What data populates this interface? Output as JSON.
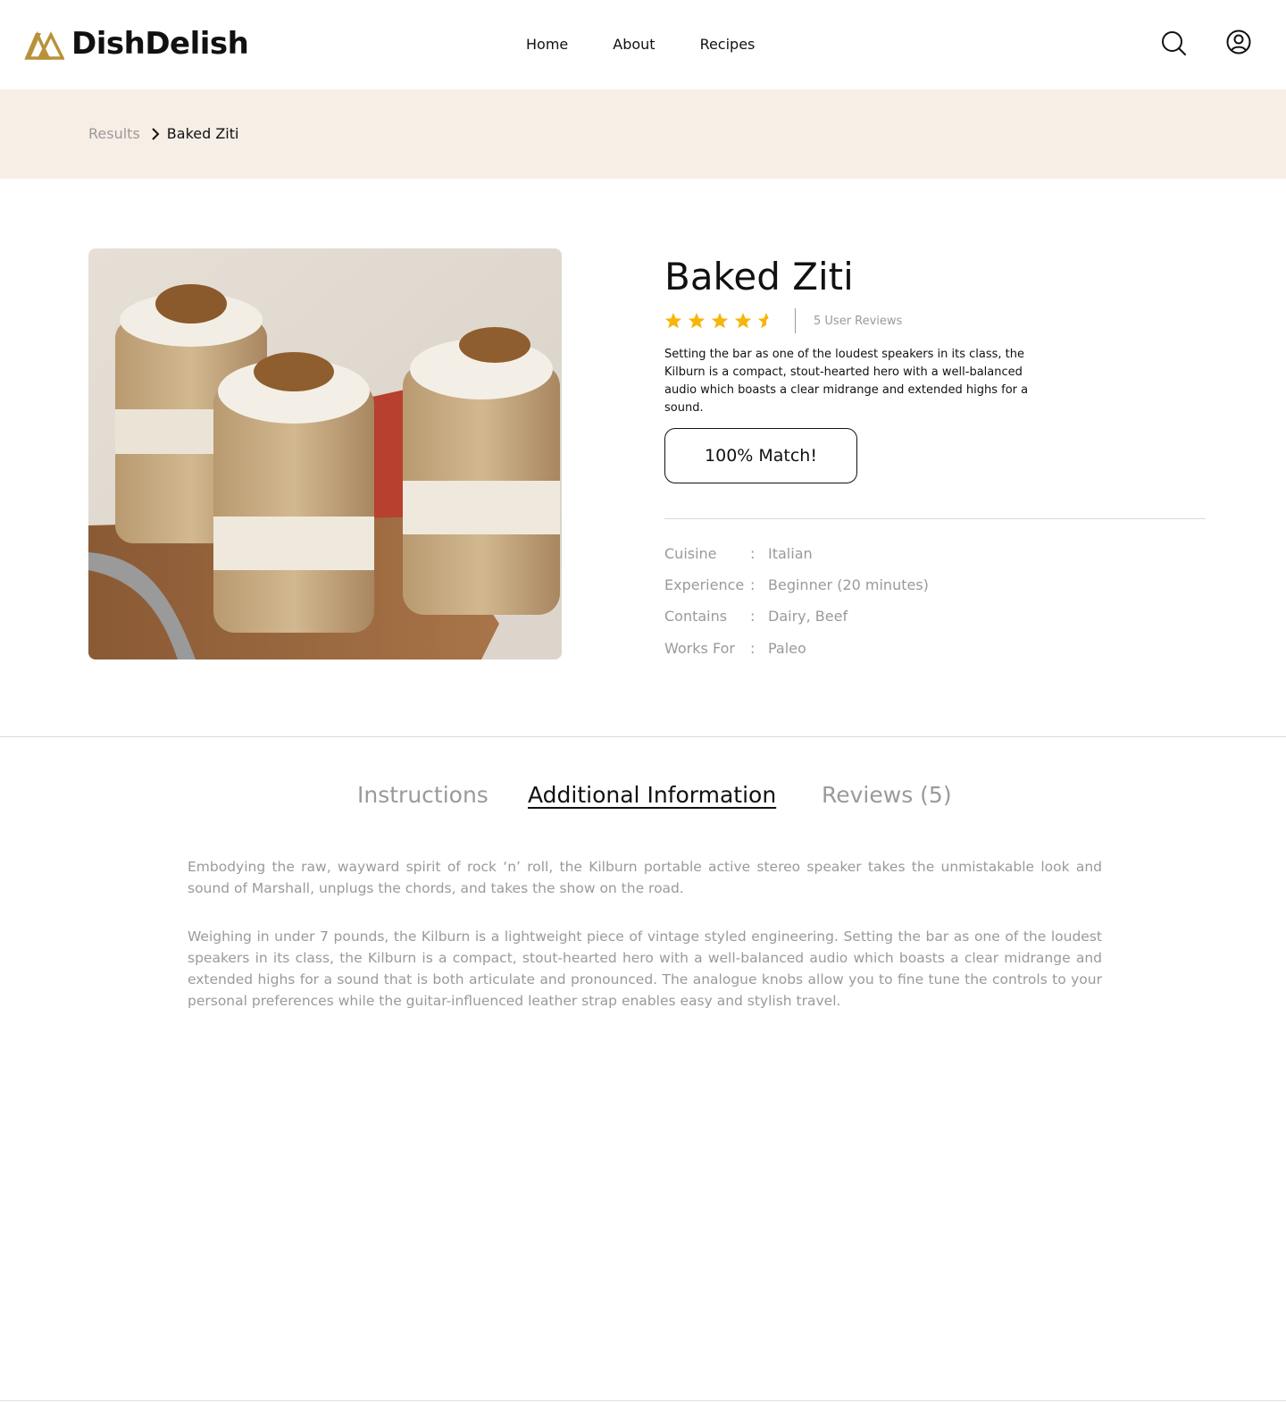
{
  "brand": {
    "name": "DishDelish",
    "accent_color": "#b8923a"
  },
  "nav": {
    "items": [
      "Home",
      "About",
      "Recipes"
    ]
  },
  "header_icons": {
    "search": "search-icon",
    "account": "user-circle-icon"
  },
  "breadcrumb": {
    "previous": "Results",
    "current": "Baked Ziti"
  },
  "recipe": {
    "title": "Baked Ziti",
    "rating": 4.5,
    "rating_max": 5,
    "star_color": "#f5b50a",
    "reviews_label": "5 User Reviews",
    "description": "Setting the bar as one of the loudest speakers in its class, the Kilburn is a compact, stout-hearted hero with a well-balanced audio which boasts a clear midrange and extended highs for a sound.",
    "match_label": "100% Match!",
    "specs": [
      {
        "key": "Cuisine",
        "value": "Italian"
      },
      {
        "key": "Experience",
        "value": "Beginner (20 minutes)"
      },
      {
        "key": "Contains",
        "value": "Dairy, Beef"
      },
      {
        "key": "Works For",
        "value": "Paleo"
      }
    ]
  },
  "tabs": {
    "items": [
      "Instructions",
      "Additional Information",
      "Reviews (5)"
    ],
    "active": "Additional Information"
  },
  "content": {
    "paragraphs": [
      "Embodying the raw, wayward spirit of rock ‘n’ roll, the Kilburn portable active stereo speaker takes the unmistakable look and sound of Marshall, unplugs the chords, and takes the show on the road.",
      "Weighing in under 7 pounds, the Kilburn is a lightweight piece of vintage styled engineering. Setting the bar as one of the loudest speakers in its class, the Kilburn is a compact, stout-hearted hero with a well-balanced audio which boasts a clear midrange and extended highs for a sound that is both articulate and pronounced. The analogue knobs allow you to fine tune the controls to your personal preferences while the guitar-influenced leather strap enables easy and stylish travel."
    ]
  }
}
